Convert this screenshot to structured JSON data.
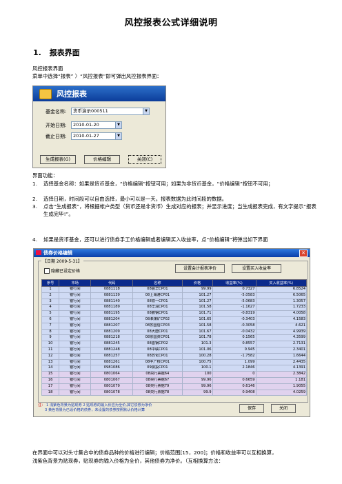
{
  "doc_title": "风控报表公式详细说明",
  "section1": {
    "num": "1.",
    "title": "报表界面"
  },
  "intro": [
    "风控报表界面",
    "菜单中选择“报表” 〉“风控报表”即可弹出风控报表界面："
  ],
  "dialog1": {
    "title": "风控报表",
    "fund_label": "基金名称:",
    "fund_value": "货币演示000511",
    "start_label": "开始日期:",
    "start_value": "2010-01-20",
    "end_label": "截止日期:",
    "end_value": "2010-01-27",
    "buttons": [
      "生成报表(G)",
      "价格编辑",
      "关闭(C)"
    ]
  },
  "functions_label": "界面功能：",
  "functions": [
    {
      "num": "1.",
      "text": "选择基金名称：如果是货币基金，“价格编辑”按钮可用；如果为非货币基金，“价格编辑”按钮不可用；"
    },
    {
      "num": "2.",
      "text": "选择日期，时间段可以自由选择，最小可以是一天。报表数据为此时间段的数据。"
    },
    {
      "num": "3.",
      "text": "点击“生成报表”，将根据帐户类型（货币还是非货币）生成对应的报表；并显示进度；当生成报表完成，有文字提示“报表生成完毕!”。"
    },
    {
      "num": "4.",
      "text": "如果是货币基金，还可以进行债券手工价格编辑或者编辑买入收益率，点“价格编辑”将弹出如下界面"
    }
  ],
  "dialog2": {
    "title": "债券价格编辑",
    "close": "✕",
    "group_label": "【日期 2009-5-31】",
    "checkbox_label": "隐藏已设定价格",
    "btn_set_manual": "设置会计报表净价",
    "btn_set_yield": "设置买入收益率",
    "headers": [
      "序号",
      "市场",
      "代码",
      "名称",
      "价格",
      "收益率(%)",
      "买入收益率(%)"
    ],
    "rows": [
      [
        "1",
        "银行间",
        "0881118",
        "08晨华CP01",
        "99.99",
        "0.7327",
        "6.8524"
      ],
      [
        "2",
        "银行间",
        "0881139",
        "08上海港CP01",
        "101.27",
        "-5.0583",
        "6.5065"
      ],
      [
        "3",
        "银行间",
        "0881140",
        "08铁一CP01",
        "101.27",
        "-5.0683",
        "1.3057"
      ],
      [
        "4",
        "银行间",
        "0881189",
        "08华润CP01",
        "101.58",
        "-1.1627",
        "1.7233"
      ],
      [
        "5",
        "银行间",
        "0881195",
        "08鹏钢CP01",
        "101.71",
        "-0.8319",
        "4.0058"
      ],
      [
        "6",
        "银行间",
        "0881204",
        "08淮煤矿CP02",
        "101.65",
        "-0.3403",
        "4.1583"
      ],
      [
        "7",
        "银行间",
        "0881207",
        "08苏国信CP03",
        "101.58",
        "-0.3058",
        "4.621"
      ],
      [
        "8",
        "银行间",
        "0881209",
        "08大唐CP01",
        "101.67",
        "-0.0432",
        "4.9939"
      ],
      [
        "9",
        "银行间",
        "0881218",
        "08京国资CP01",
        "101.78",
        "0.1565",
        "4.3599"
      ],
      [
        "10",
        "银行间",
        "0881245",
        "08首钢CP02",
        "101.3",
        "0.8557",
        "2.7131"
      ],
      [
        "11",
        "银行间",
        "0881248",
        "08中联CP01",
        "101.06",
        "0.945",
        "2.3401"
      ],
      [
        "12",
        "银行间",
        "0881257",
        "08苏化CP01",
        "100.28",
        "-1.7582",
        "1.6644"
      ],
      [
        "13",
        "银行间",
        "0881261",
        "08中广核CP01",
        "100.75",
        "1.099",
        "2.4435"
      ],
      [
        "14",
        "银行间",
        "0981086",
        "09陕投CP01",
        "100.1",
        "2.1846",
        "4.1391"
      ],
      [
        "15",
        "银行间",
        "0801064",
        "08央行票据64",
        "100",
        "0",
        "2.3842"
      ],
      [
        "16",
        "银行间",
        "0801067",
        "08央行票据67",
        "99.96",
        "0.6659",
        "1.181"
      ],
      [
        "17",
        "银行间",
        "0801079",
        "08央行票据79",
        "99.96",
        "0.6146",
        "1.9055"
      ],
      [
        "18",
        "银行间",
        "0801078",
        "08央行票据78",
        "99.9",
        "0.9408",
        "4.0259"
      ]
    ],
    "note_prefix": "注：",
    "note_lines": [
      "1  浅紫色背景为贴现券    2  贴现券的输入价应为全价,其它债券为净价",
      "3  黄色背景为已设价格的债券，未设置的债券按照默认价格计算"
    ],
    "save_label": "保存",
    "close_label": "关闭"
  },
  "footer_lines": [
    "在界面中可以对头寸集合中的债券品种的价格进行编辑；价格范围[15，200]；价格和收益率可以互相换算，",
    "浅紫色背景为贴现券，贴现券的输入价格为全价，其他债券为净价。（互相换算方法："
  ]
}
